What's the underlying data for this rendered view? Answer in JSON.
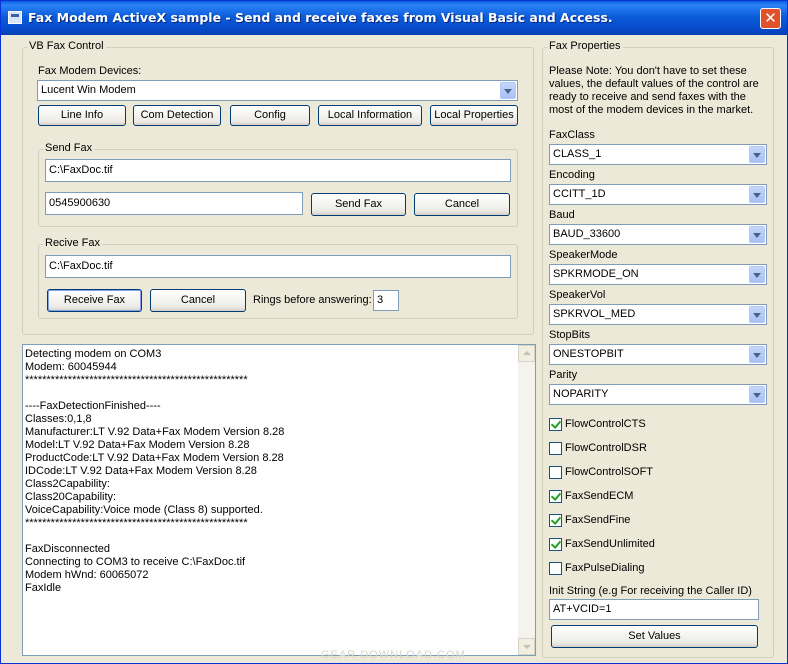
{
  "window": {
    "title": "Fax Modem ActiveX sample - Send and receive faxes from Visual Basic and Access."
  },
  "vb_group": {
    "legend": "VB Fax Control",
    "devices_label": "Fax Modem Devices:",
    "device_selected": "Lucent Win Modem",
    "buttons": {
      "line_info": "Line Info",
      "com_detection": "Com Detection",
      "config": "Config",
      "local_information": "Local Information",
      "local_properties": "Local Properties"
    }
  },
  "send_fax": {
    "legend": "Send Fax",
    "file": "C:\\FaxDoc.tif",
    "number": "0545900630",
    "send_label": "Send Fax",
    "cancel_label": "Cancel"
  },
  "receive_fax": {
    "legend": "Recive Fax",
    "file": "C:\\FaxDoc.tif",
    "receive_label": "Receive Fax",
    "cancel_label": "Cancel",
    "rings_label": "Rings before answering:",
    "rings_value": "3"
  },
  "log": {
    "lines": [
      "Detecting modem on COM3",
      "Modem: 60045944",
      "****************************************************",
      "",
      "----FaxDetectionFinished----",
      "Classes:0,1,8",
      "Manufacturer:LT V.92 Data+Fax Modem Version 8.28",
      "Model:LT V.92 Data+Fax Modem Version 8.28",
      "ProductCode:LT V.92 Data+Fax Modem Version 8.28",
      "IDCode:LT V.92 Data+Fax Modem Version 8.28",
      "Class2Capability:",
      "Class20Capability:",
      "VoiceCapability:Voice mode (Class 8) supported.",
      "****************************************************",
      "",
      "FaxDisconnected",
      "Connecting to COM3 to receive C:\\FaxDoc.tif",
      "Modem hWnd: 60065072",
      "FaxIdle"
    ]
  },
  "props": {
    "legend": "Fax Properties",
    "note": "Please Note: You don't have to set these values, the default values of the control are ready to receive and send faxes with the most of the modem devices in the market.",
    "fields": [
      {
        "label": "FaxClass",
        "value": "CLASS_1"
      },
      {
        "label": "Encoding",
        "value": "CCITT_1D"
      },
      {
        "label": "Baud",
        "value": "BAUD_33600"
      },
      {
        "label": "SpeakerMode",
        "value": "SPKRMODE_ON"
      },
      {
        "label": "SpeakerVol",
        "value": "SPKRVOL_MED"
      },
      {
        "label": "StopBits",
        "value": "ONESTOPBIT"
      },
      {
        "label": "Parity",
        "value": "NOPARITY"
      }
    ],
    "checks": [
      {
        "label": "FlowControlCTS",
        "checked": true
      },
      {
        "label": "FlowControlDSR",
        "checked": false
      },
      {
        "label": "FlowControlSOFT",
        "checked": false
      },
      {
        "label": "FaxSendECM",
        "checked": true
      },
      {
        "label": "FaxSendFine",
        "checked": true
      },
      {
        "label": "FaxSendUnlimited",
        "checked": true
      },
      {
        "label": "FaxPulseDialing",
        "checked": false
      }
    ],
    "init_label": "Init String (e.g For receiving the Caller ID)",
    "init_value": "AT+VCID=1",
    "set_values_label": "Set Values"
  },
  "watermark": "GEAR DOWNLOAD.COM"
}
